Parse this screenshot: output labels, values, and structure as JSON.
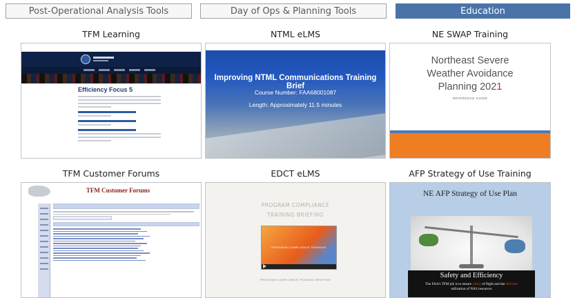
{
  "tabs": [
    {
      "label": "Post-Operational Analysis Tools",
      "active": false
    },
    {
      "label": "Day of Ops & Planning Tools",
      "active": false
    },
    {
      "label": "Education",
      "active": true
    }
  ],
  "colors": {
    "active_tab": "#4a74a8",
    "tab_border": "#9da2a8"
  },
  "cards": {
    "tfm_learning": {
      "title": "TFM Learning",
      "preview": {
        "heading": "Efficiency Focus 5"
      }
    },
    "ntml_elms": {
      "title": "NTML eLMS",
      "preview": {
        "heading": "Improving NTML Communications Training Brief",
        "course_number": "Course Number: FAA68001087",
        "length": "Length: Approximately 11.5 minutes"
      }
    },
    "ne_swap": {
      "title": "NE SWAP Training",
      "preview": {
        "line1": "Northeast Severe",
        "line2": "Weather Avoidance",
        "line3_prefix": "Planning 202",
        "line3_suffix": "1",
        "subtitle": "REFERENCE GUIDE"
      }
    },
    "tfm_forums": {
      "title": "TFM Customer Forums",
      "preview": {
        "heading": "TFM Customer Forums"
      }
    },
    "edct_elms": {
      "title": "EDCT eLMS",
      "preview": {
        "heading_line1": "PROGRAM COMPLIANCE",
        "heading_line2": "TRAINING BRIEFING",
        "video_label": "PROGRAM COMPLIANCE TRAINING",
        "caption": "PROGRAM COMPLIANCE TRAINING BRIEFING"
      }
    },
    "afp_strategy": {
      "title": "AFP Strategy of Use Training",
      "preview": {
        "heading": "NE AFP Strategy of Use Plan",
        "band_title": "Safety and Efficiency",
        "band_text_1": "The FAA's TFM job is to ensure",
        "band_hl_1": "safety",
        "band_text_2": "of flight and the",
        "band_hl_2": "efficient",
        "band_text_3": "utilization of NAS resources"
      }
    }
  }
}
